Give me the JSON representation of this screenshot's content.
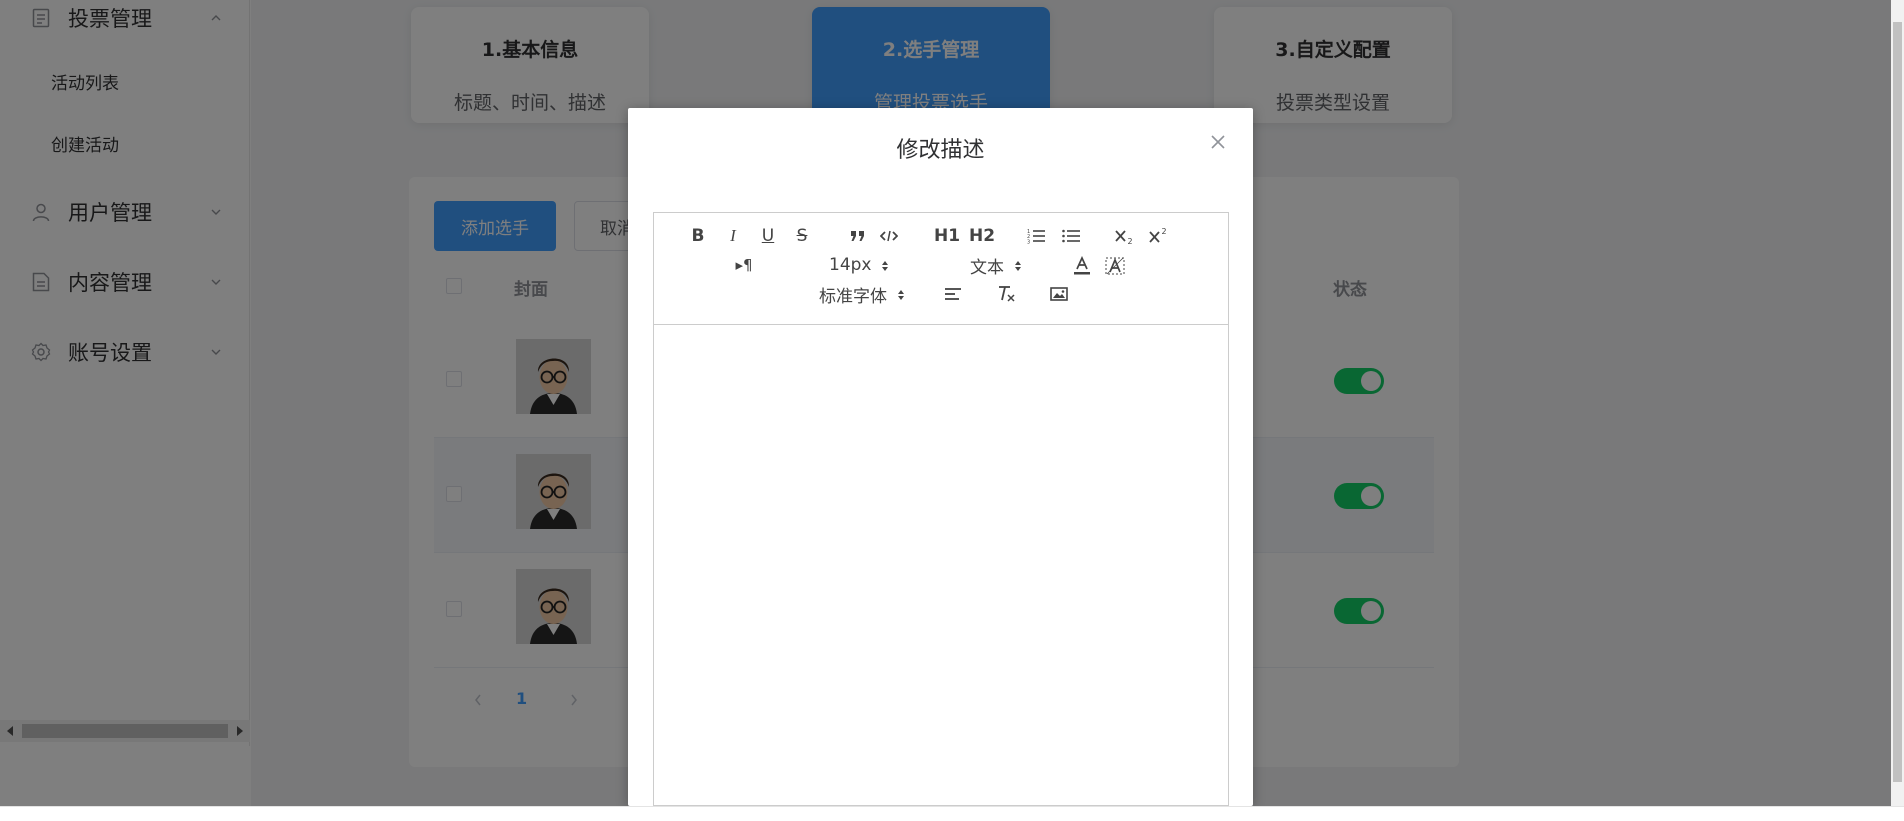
{
  "sidebar": {
    "menu_vote": "投票管理",
    "sub_items": [
      "活动列表",
      "创建活动"
    ],
    "menu_user": "用户管理",
    "menu_content": "内容管理",
    "menu_account": "账号设置"
  },
  "steps": [
    {
      "title": "1.基本信息",
      "desc": "标题、时间、描述"
    },
    {
      "title": "2.选手管理",
      "desc": "管理投票选手"
    },
    {
      "title": "3.自定义配置",
      "desc": "投票类型设置"
    }
  ],
  "panel": {
    "add_button": "添加选手",
    "cancel_button": "取消",
    "col_cover": "封面",
    "col_status": "状态",
    "page_current": "1"
  },
  "dialog": {
    "title": "修改描述",
    "editor": {
      "bold": "B",
      "italic": "I",
      "underline": "U",
      "strike": "S",
      "h1": "H1",
      "h2": "H2",
      "rtl": "▸¶",
      "size_value": "14px",
      "header_value": "文本",
      "font_value": "标准字体",
      "content": ""
    }
  },
  "colors": {
    "primary": "#409eff",
    "switch_on": "#13ce66",
    "overlay": "rgba(0,0,0,0.5)"
  }
}
